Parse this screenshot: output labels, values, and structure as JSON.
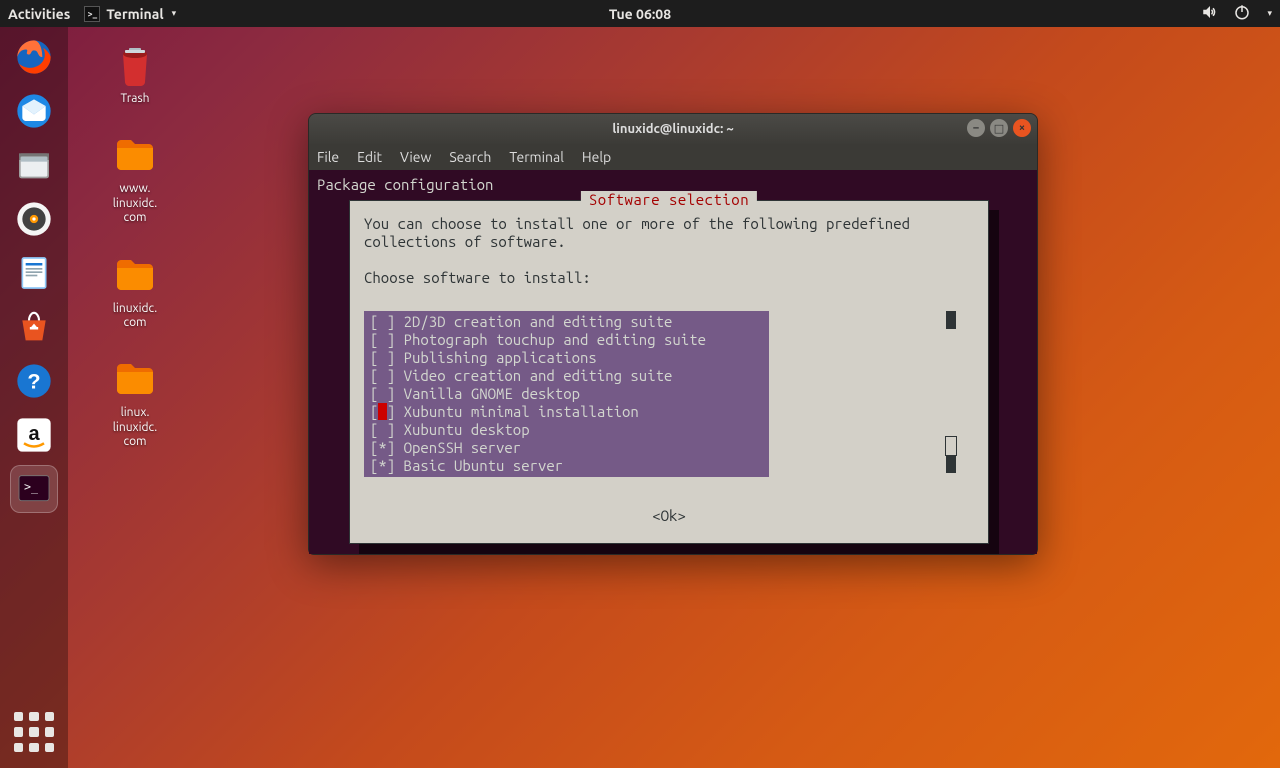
{
  "topbar": {
    "activities": "Activities",
    "app_label": "Terminal",
    "clock": "Tue 06:08"
  },
  "dock": {
    "items": [
      "firefox",
      "thunderbird",
      "files",
      "rhythmbox",
      "writer",
      "software",
      "help",
      "amazon",
      "terminal"
    ]
  },
  "desktop": {
    "trash": "Trash",
    "folder1": "www.\nlinuxidc.\ncom",
    "folder2": "linuxidc.\ncom",
    "folder3": "linux.\nlinuxidc.\ncom"
  },
  "window": {
    "title": "linuxidc@linuxidc: ~",
    "menus": [
      "File",
      "Edit",
      "View",
      "Search",
      "Terminal",
      "Help"
    ]
  },
  "tasksel": {
    "header": "Package configuration",
    "box_title": "Software selection",
    "lead1": "You can choose to install one or more of the following predefined",
    "lead2": "collections of software.",
    "prompt": "Choose software to install:",
    "options": [
      {
        "mark": " ",
        "label": "2D/3D creation and editing suite",
        "cursor": false
      },
      {
        "mark": " ",
        "label": "Photograph touchup and editing suite",
        "cursor": false
      },
      {
        "mark": " ",
        "label": "Publishing applications",
        "cursor": false
      },
      {
        "mark": " ",
        "label": "Video creation and editing suite",
        "cursor": false
      },
      {
        "mark": " ",
        "label": "Vanilla GNOME desktop",
        "cursor": false
      },
      {
        "mark": " ",
        "label": "Xubuntu minimal installation",
        "cursor": true
      },
      {
        "mark": " ",
        "label": "Xubuntu desktop",
        "cursor": false
      },
      {
        "mark": "*",
        "label": "OpenSSH server",
        "cursor": false
      },
      {
        "mark": "*",
        "label": "Basic Ubuntu server",
        "cursor": false
      }
    ],
    "ok": "<Ok>"
  }
}
